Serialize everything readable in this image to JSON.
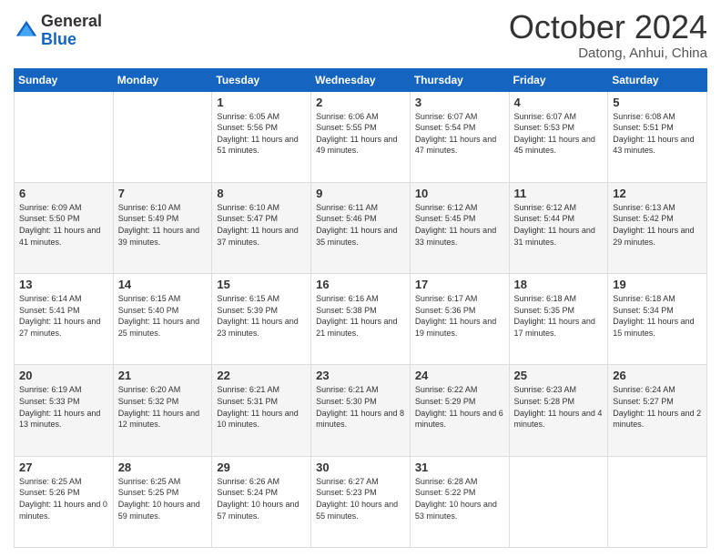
{
  "logo": {
    "line1": "General",
    "line2": "Blue"
  },
  "title": "October 2024",
  "subtitle": "Datong, Anhui, China",
  "days_header": [
    "Sunday",
    "Monday",
    "Tuesday",
    "Wednesday",
    "Thursday",
    "Friday",
    "Saturday"
  ],
  "weeks": [
    [
      {
        "day": "",
        "info": ""
      },
      {
        "day": "",
        "info": ""
      },
      {
        "day": "1",
        "info": "Sunrise: 6:05 AM\nSunset: 5:56 PM\nDaylight: 11 hours and 51 minutes."
      },
      {
        "day": "2",
        "info": "Sunrise: 6:06 AM\nSunset: 5:55 PM\nDaylight: 11 hours and 49 minutes."
      },
      {
        "day": "3",
        "info": "Sunrise: 6:07 AM\nSunset: 5:54 PM\nDaylight: 11 hours and 47 minutes."
      },
      {
        "day": "4",
        "info": "Sunrise: 6:07 AM\nSunset: 5:53 PM\nDaylight: 11 hours and 45 minutes."
      },
      {
        "day": "5",
        "info": "Sunrise: 6:08 AM\nSunset: 5:51 PM\nDaylight: 11 hours and 43 minutes."
      }
    ],
    [
      {
        "day": "6",
        "info": "Sunrise: 6:09 AM\nSunset: 5:50 PM\nDaylight: 11 hours and 41 minutes."
      },
      {
        "day": "7",
        "info": "Sunrise: 6:10 AM\nSunset: 5:49 PM\nDaylight: 11 hours and 39 minutes."
      },
      {
        "day": "8",
        "info": "Sunrise: 6:10 AM\nSunset: 5:47 PM\nDaylight: 11 hours and 37 minutes."
      },
      {
        "day": "9",
        "info": "Sunrise: 6:11 AM\nSunset: 5:46 PM\nDaylight: 11 hours and 35 minutes."
      },
      {
        "day": "10",
        "info": "Sunrise: 6:12 AM\nSunset: 5:45 PM\nDaylight: 11 hours and 33 minutes."
      },
      {
        "day": "11",
        "info": "Sunrise: 6:12 AM\nSunset: 5:44 PM\nDaylight: 11 hours and 31 minutes."
      },
      {
        "day": "12",
        "info": "Sunrise: 6:13 AM\nSunset: 5:42 PM\nDaylight: 11 hours and 29 minutes."
      }
    ],
    [
      {
        "day": "13",
        "info": "Sunrise: 6:14 AM\nSunset: 5:41 PM\nDaylight: 11 hours and 27 minutes."
      },
      {
        "day": "14",
        "info": "Sunrise: 6:15 AM\nSunset: 5:40 PM\nDaylight: 11 hours and 25 minutes."
      },
      {
        "day": "15",
        "info": "Sunrise: 6:15 AM\nSunset: 5:39 PM\nDaylight: 11 hours and 23 minutes."
      },
      {
        "day": "16",
        "info": "Sunrise: 6:16 AM\nSunset: 5:38 PM\nDaylight: 11 hours and 21 minutes."
      },
      {
        "day": "17",
        "info": "Sunrise: 6:17 AM\nSunset: 5:36 PM\nDaylight: 11 hours and 19 minutes."
      },
      {
        "day": "18",
        "info": "Sunrise: 6:18 AM\nSunset: 5:35 PM\nDaylight: 11 hours and 17 minutes."
      },
      {
        "day": "19",
        "info": "Sunrise: 6:18 AM\nSunset: 5:34 PM\nDaylight: 11 hours and 15 minutes."
      }
    ],
    [
      {
        "day": "20",
        "info": "Sunrise: 6:19 AM\nSunset: 5:33 PM\nDaylight: 11 hours and 13 minutes."
      },
      {
        "day": "21",
        "info": "Sunrise: 6:20 AM\nSunset: 5:32 PM\nDaylight: 11 hours and 12 minutes."
      },
      {
        "day": "22",
        "info": "Sunrise: 6:21 AM\nSunset: 5:31 PM\nDaylight: 11 hours and 10 minutes."
      },
      {
        "day": "23",
        "info": "Sunrise: 6:21 AM\nSunset: 5:30 PM\nDaylight: 11 hours and 8 minutes."
      },
      {
        "day": "24",
        "info": "Sunrise: 6:22 AM\nSunset: 5:29 PM\nDaylight: 11 hours and 6 minutes."
      },
      {
        "day": "25",
        "info": "Sunrise: 6:23 AM\nSunset: 5:28 PM\nDaylight: 11 hours and 4 minutes."
      },
      {
        "day": "26",
        "info": "Sunrise: 6:24 AM\nSunset: 5:27 PM\nDaylight: 11 hours and 2 minutes."
      }
    ],
    [
      {
        "day": "27",
        "info": "Sunrise: 6:25 AM\nSunset: 5:26 PM\nDaylight: 11 hours and 0 minutes."
      },
      {
        "day": "28",
        "info": "Sunrise: 6:25 AM\nSunset: 5:25 PM\nDaylight: 10 hours and 59 minutes."
      },
      {
        "day": "29",
        "info": "Sunrise: 6:26 AM\nSunset: 5:24 PM\nDaylight: 10 hours and 57 minutes."
      },
      {
        "day": "30",
        "info": "Sunrise: 6:27 AM\nSunset: 5:23 PM\nDaylight: 10 hours and 55 minutes."
      },
      {
        "day": "31",
        "info": "Sunrise: 6:28 AM\nSunset: 5:22 PM\nDaylight: 10 hours and 53 minutes."
      },
      {
        "day": "",
        "info": ""
      },
      {
        "day": "",
        "info": ""
      }
    ]
  ]
}
